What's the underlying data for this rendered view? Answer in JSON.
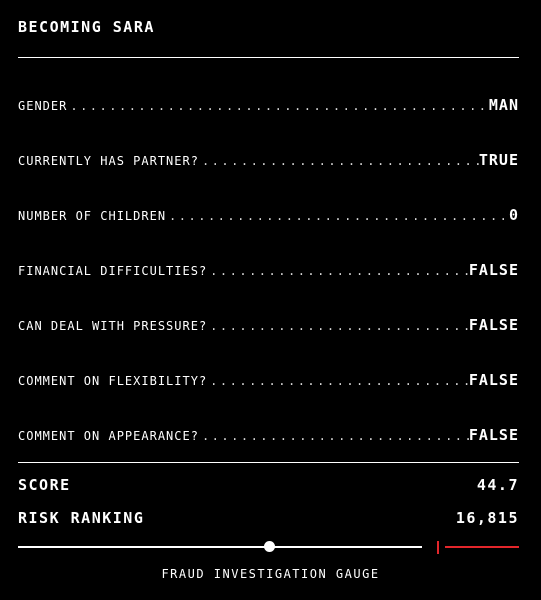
{
  "title": "BECOMING SARA",
  "rows": [
    {
      "label": "GENDER",
      "value": "MAN"
    },
    {
      "label": "CURRENTLY HAS PARTNER?",
      "value": "TRUE"
    },
    {
      "label": "NUMBER OF CHILDREN",
      "value": "0"
    },
    {
      "label": "FINANCIAL DIFFICULTIES?",
      "value": "FALSE"
    },
    {
      "label": "CAN DEAL WITH PRESSURE?",
      "value": "FALSE"
    },
    {
      "label": "COMMENT ON FLEXIBILITY?",
      "value": "FALSE"
    },
    {
      "label": "COMMENT ON APPEARANCE?",
      "value": "FALSE"
    }
  ],
  "score": {
    "label": "SCORE",
    "value": "44.7"
  },
  "risk": {
    "label": "RISK RANKING",
    "value": "16,815"
  },
  "gauge": {
    "label": "FRAUD INVESTIGATION GAUGE",
    "position": 0.5,
    "threshold": 0.82,
    "colors": {
      "track": "#ffffff",
      "danger": "#e3262b"
    }
  },
  "colors": {
    "background": "#000000",
    "text": "#ffffff",
    "accent": "#e3262b"
  }
}
